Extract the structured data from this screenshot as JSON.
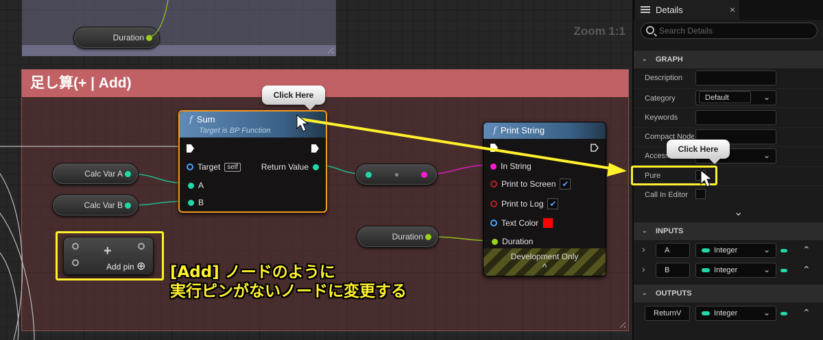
{
  "graph": {
    "zoom_label": "Zoom 1:1",
    "comment_title": "足し算(+ | Add)",
    "duration_top_label": "Duration",
    "calc_var_a_label": "Calc Var A",
    "calc_var_b_label": "Calc Var B",
    "duration_label": "Duration",
    "sum_node": {
      "icon": "f",
      "title": "Sum",
      "subtitle": "Target is BP Function",
      "target_label": "Target",
      "self_badge": "self",
      "return_label": "Return Value",
      "a_label": "A",
      "b_label": "B"
    },
    "print_node": {
      "icon": "f",
      "title": "Print String",
      "in_string_label": "In String",
      "print_screen_label": "Print to Screen",
      "print_log_label": "Print to Log",
      "text_color_label": "Text Color",
      "duration_label": "Duration",
      "dev_only_label": "Development Only",
      "collapse_glyph": "^",
      "check_glyph": "✔",
      "text_color": "#ff0000"
    },
    "add_pin_node": {
      "plus_glyph": "+",
      "label": "Add pin",
      "circle_plus_glyph": "⊕"
    },
    "callout_left": "Click Here",
    "callout_right": "Click Here",
    "jp_note_line1": "[Add] ノードのように",
    "jp_note_line2": "実行ピンがないノードに変更する",
    "colors": {
      "highlight": "#fff12c",
      "float_pin": "#21d8a6",
      "string_pin": "#ff1ad2",
      "bool_pin": "#b22222"
    }
  },
  "details": {
    "tab_label": "Details",
    "tab_close": "×",
    "search_placeholder": "Search Details",
    "graph_section": "GRAPH",
    "props": {
      "description": "Description",
      "category": "Category",
      "category_value": "Default",
      "keywords": "Keywords",
      "compact_node": "Compact Node Title",
      "access": "Access Specifier",
      "pure": "Pure",
      "call_in_editor": "Call In Editor"
    },
    "expand_glyph": "⌄",
    "inputs_section": "INPUTS",
    "inputs": [
      {
        "name": "A",
        "type": "Integer"
      },
      {
        "name": "B",
        "type": "Integer"
      }
    ],
    "outputs_section": "OUTPUTS",
    "outputs": [
      {
        "name": "ReturnV",
        "type": "Integer"
      }
    ],
    "section_chevron": "⌄",
    "row_arrow": "›",
    "combo_arrow": "⌄",
    "move_up": "⌃"
  }
}
